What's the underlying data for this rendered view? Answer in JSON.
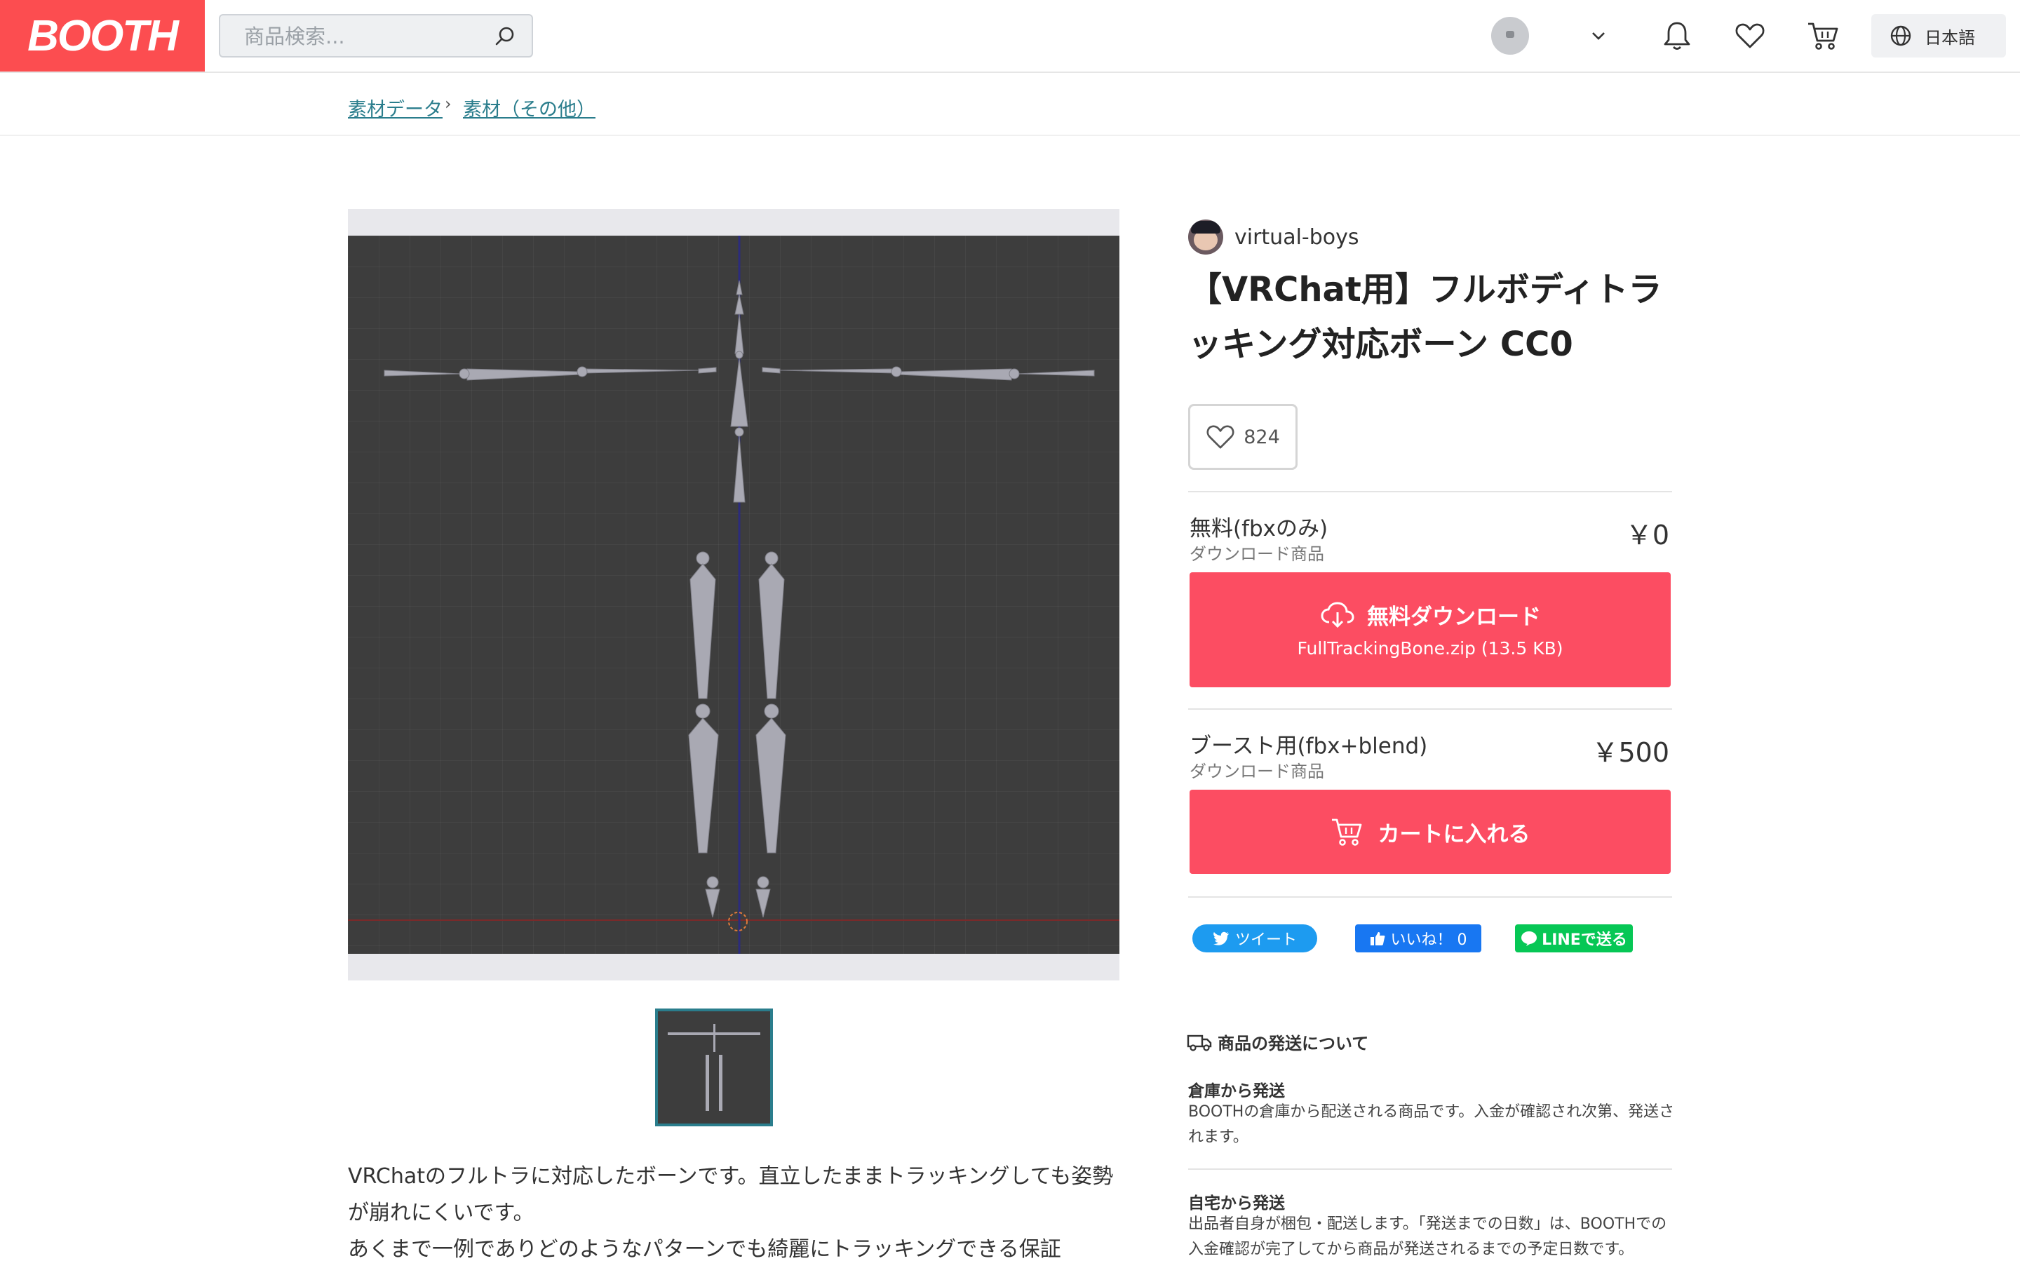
{
  "header": {
    "logo_text": "BOOTH",
    "search_placeholder": "商品検索...",
    "language_label": "日本語",
    "icons": [
      "search-icon",
      "chevron-down-icon",
      "bell-icon",
      "heart-icon",
      "cart-icon",
      "globe-icon"
    ]
  },
  "breadcrumb": [
    {
      "label": "素材データ"
    },
    {
      "label": "素材（その他）"
    }
  ],
  "breadcrumb_sep": "›",
  "shop": {
    "name": "virtual-boys"
  },
  "product": {
    "title": "【VRChat用】フルボディトラッキング対応ボーン CC0",
    "likes": "824"
  },
  "variants": [
    {
      "name": "無料(fbxのみ)",
      "type": "ダウンロード商品",
      "price": "￥0",
      "button_label": "無料ダウンロード",
      "file": "FullTrackingBone.zip (13.5 KB)"
    },
    {
      "name": "ブースト用(fbx+blend)",
      "type": "ダウンロード商品",
      "price": "￥500",
      "button_label": "カートに入れる"
    }
  ],
  "social": {
    "tweet": "ツイート",
    "like": "いいね！ 0",
    "line": "LINEで送る"
  },
  "shipping": {
    "heading": "商品の発送について",
    "warehouse_title": "倉庫から発送",
    "warehouse_desc": "BOOTHの倉庫から配送される商品です。入金が確認され次第、発送されます。",
    "home_title": "自宅から発送",
    "home_desc": "出品者自身が梱包・配送します。「発送までの日数」は、BOOTHでの入金確認が完了してから商品が発送されるまでの予定日数です。"
  },
  "description": [
    "VRChatのフルトラに対応したボーンです。直立したままトラッキングしても姿勢が崩れにくいです。",
    "あくまで一例でありどのようなパターンでも綺麗にトラッキングできる保証"
  ],
  "colors": {
    "brand": "#fc4d50",
    "button": "#fc4d62",
    "link": "#2a7d8c",
    "twitter": "#1d9bf0",
    "facebook": "#1877f2",
    "line": "#06c755"
  }
}
